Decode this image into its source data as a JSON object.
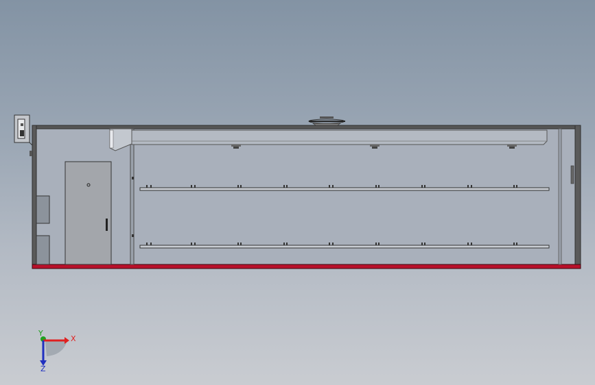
{
  "viewport": {
    "background_top": "#8393a4",
    "background_bottom": "#c9ccd1"
  },
  "model": {
    "shelf_rows": 2,
    "shelf_brackets_per_row": 9,
    "ceiling_fixtures": 3,
    "floor_color": "#b8102a",
    "wall_color": "#4a4a4a",
    "interior_color": "#a9b0bb"
  },
  "triad": {
    "x_label": "X",
    "y_label": "Y",
    "z_label": "Z",
    "x_color": "#e02020",
    "y_color": "#20a020",
    "z_color": "#2030c0"
  }
}
